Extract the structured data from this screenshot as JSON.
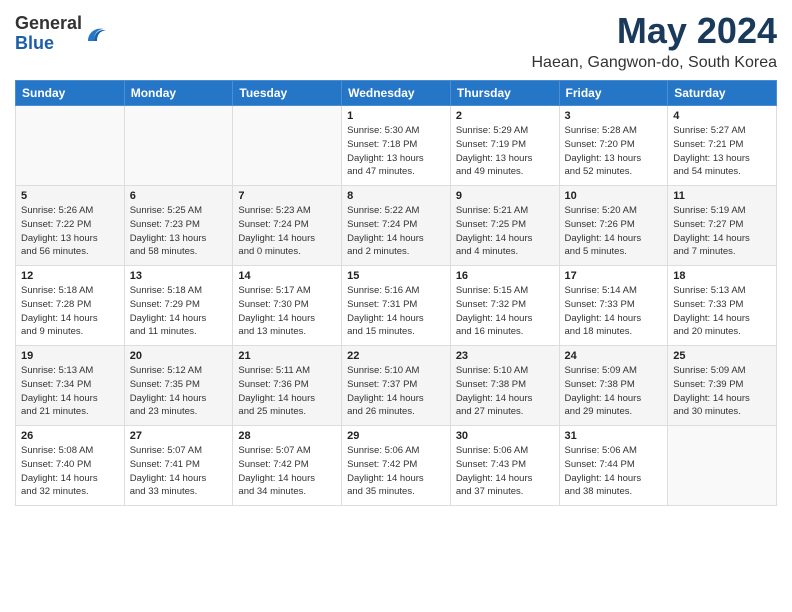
{
  "logo": {
    "general": "General",
    "blue": "Blue"
  },
  "header": {
    "month": "May 2024",
    "location": "Haean, Gangwon-do, South Korea"
  },
  "weekdays": [
    "Sunday",
    "Monday",
    "Tuesday",
    "Wednesday",
    "Thursday",
    "Friday",
    "Saturday"
  ],
  "weeks": [
    [
      {
        "day": "",
        "info": ""
      },
      {
        "day": "",
        "info": ""
      },
      {
        "day": "",
        "info": ""
      },
      {
        "day": "1",
        "info": "Sunrise: 5:30 AM\nSunset: 7:18 PM\nDaylight: 13 hours\nand 47 minutes."
      },
      {
        "day": "2",
        "info": "Sunrise: 5:29 AM\nSunset: 7:19 PM\nDaylight: 13 hours\nand 49 minutes."
      },
      {
        "day": "3",
        "info": "Sunrise: 5:28 AM\nSunset: 7:20 PM\nDaylight: 13 hours\nand 52 minutes."
      },
      {
        "day": "4",
        "info": "Sunrise: 5:27 AM\nSunset: 7:21 PM\nDaylight: 13 hours\nand 54 minutes."
      }
    ],
    [
      {
        "day": "5",
        "info": "Sunrise: 5:26 AM\nSunset: 7:22 PM\nDaylight: 13 hours\nand 56 minutes."
      },
      {
        "day": "6",
        "info": "Sunrise: 5:25 AM\nSunset: 7:23 PM\nDaylight: 13 hours\nand 58 minutes."
      },
      {
        "day": "7",
        "info": "Sunrise: 5:23 AM\nSunset: 7:24 PM\nDaylight: 14 hours\nand 0 minutes."
      },
      {
        "day": "8",
        "info": "Sunrise: 5:22 AM\nSunset: 7:24 PM\nDaylight: 14 hours\nand 2 minutes."
      },
      {
        "day": "9",
        "info": "Sunrise: 5:21 AM\nSunset: 7:25 PM\nDaylight: 14 hours\nand 4 minutes."
      },
      {
        "day": "10",
        "info": "Sunrise: 5:20 AM\nSunset: 7:26 PM\nDaylight: 14 hours\nand 5 minutes."
      },
      {
        "day": "11",
        "info": "Sunrise: 5:19 AM\nSunset: 7:27 PM\nDaylight: 14 hours\nand 7 minutes."
      }
    ],
    [
      {
        "day": "12",
        "info": "Sunrise: 5:18 AM\nSunset: 7:28 PM\nDaylight: 14 hours\nand 9 minutes."
      },
      {
        "day": "13",
        "info": "Sunrise: 5:18 AM\nSunset: 7:29 PM\nDaylight: 14 hours\nand 11 minutes."
      },
      {
        "day": "14",
        "info": "Sunrise: 5:17 AM\nSunset: 7:30 PM\nDaylight: 14 hours\nand 13 minutes."
      },
      {
        "day": "15",
        "info": "Sunrise: 5:16 AM\nSunset: 7:31 PM\nDaylight: 14 hours\nand 15 minutes."
      },
      {
        "day": "16",
        "info": "Sunrise: 5:15 AM\nSunset: 7:32 PM\nDaylight: 14 hours\nand 16 minutes."
      },
      {
        "day": "17",
        "info": "Sunrise: 5:14 AM\nSunset: 7:33 PM\nDaylight: 14 hours\nand 18 minutes."
      },
      {
        "day": "18",
        "info": "Sunrise: 5:13 AM\nSunset: 7:33 PM\nDaylight: 14 hours\nand 20 minutes."
      }
    ],
    [
      {
        "day": "19",
        "info": "Sunrise: 5:13 AM\nSunset: 7:34 PM\nDaylight: 14 hours\nand 21 minutes."
      },
      {
        "day": "20",
        "info": "Sunrise: 5:12 AM\nSunset: 7:35 PM\nDaylight: 14 hours\nand 23 minutes."
      },
      {
        "day": "21",
        "info": "Sunrise: 5:11 AM\nSunset: 7:36 PM\nDaylight: 14 hours\nand 25 minutes."
      },
      {
        "day": "22",
        "info": "Sunrise: 5:10 AM\nSunset: 7:37 PM\nDaylight: 14 hours\nand 26 minutes."
      },
      {
        "day": "23",
        "info": "Sunrise: 5:10 AM\nSunset: 7:38 PM\nDaylight: 14 hours\nand 27 minutes."
      },
      {
        "day": "24",
        "info": "Sunrise: 5:09 AM\nSunset: 7:38 PM\nDaylight: 14 hours\nand 29 minutes."
      },
      {
        "day": "25",
        "info": "Sunrise: 5:09 AM\nSunset: 7:39 PM\nDaylight: 14 hours\nand 30 minutes."
      }
    ],
    [
      {
        "day": "26",
        "info": "Sunrise: 5:08 AM\nSunset: 7:40 PM\nDaylight: 14 hours\nand 32 minutes."
      },
      {
        "day": "27",
        "info": "Sunrise: 5:07 AM\nSunset: 7:41 PM\nDaylight: 14 hours\nand 33 minutes."
      },
      {
        "day": "28",
        "info": "Sunrise: 5:07 AM\nSunset: 7:42 PM\nDaylight: 14 hours\nand 34 minutes."
      },
      {
        "day": "29",
        "info": "Sunrise: 5:06 AM\nSunset: 7:42 PM\nDaylight: 14 hours\nand 35 minutes."
      },
      {
        "day": "30",
        "info": "Sunrise: 5:06 AM\nSunset: 7:43 PM\nDaylight: 14 hours\nand 37 minutes."
      },
      {
        "day": "31",
        "info": "Sunrise: 5:06 AM\nSunset: 7:44 PM\nDaylight: 14 hours\nand 38 minutes."
      },
      {
        "day": "",
        "info": ""
      }
    ]
  ]
}
